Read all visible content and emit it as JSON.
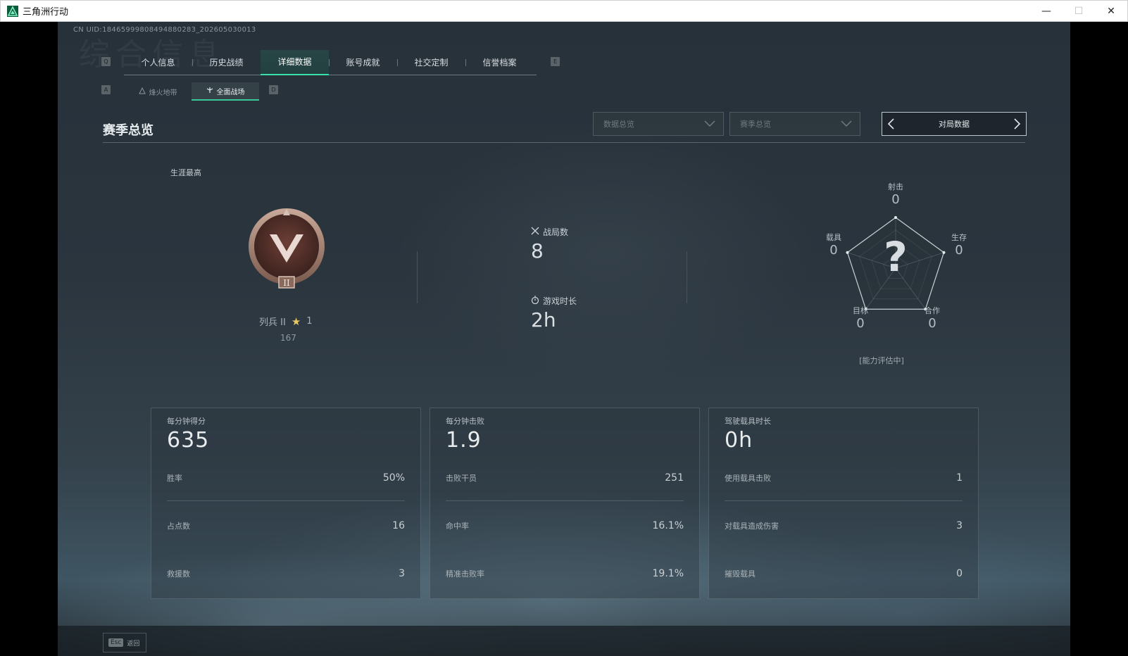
{
  "window": {
    "title": "三角洲行动",
    "minimize": "—",
    "maximize": "☐",
    "close": "✕"
  },
  "uid": "CN UID:18465999808494880283_202605030013",
  "background_text": "综合信息",
  "tabs": {
    "left_key": "Q",
    "right_key": "E",
    "items": [
      {
        "label": "个人信息",
        "active": false
      },
      {
        "label": "历史战绩",
        "active": false
      },
      {
        "label": "详细数据",
        "active": true
      },
      {
        "label": "账号成就",
        "active": false
      },
      {
        "label": "社交定制",
        "active": false
      },
      {
        "label": "信誉档案",
        "active": false
      }
    ]
  },
  "subtabs": {
    "left_key": "A",
    "right_key": "D",
    "items": [
      {
        "label": "烽火地带",
        "active": false
      },
      {
        "label": "全面战场",
        "active": true
      }
    ]
  },
  "section_title": "赛季总览",
  "filters": {
    "dropdown1": "数据总览",
    "dropdown2": "赛季总览",
    "pager": "对局数据"
  },
  "career": {
    "label": "生涯最高",
    "rank_name": "列兵 II",
    "stars": "1",
    "score": "167",
    "badge_numeral": "II"
  },
  "summary": {
    "matches_label": "战局数",
    "matches_value": "8",
    "playtime_label": "游戏时长",
    "playtime_value": "2h"
  },
  "radar": {
    "top": {
      "label": "射击",
      "value": "0"
    },
    "right": {
      "label": "生存",
      "value": "0"
    },
    "bottom_right": {
      "label": "合作",
      "value": "0"
    },
    "bottom_left": {
      "label": "目标",
      "value": "0"
    },
    "left": {
      "label": "载具",
      "value": "0"
    },
    "center_glyph": "?",
    "status": "[能力评估中]",
    "values": [
      0,
      0,
      0,
      0,
      0
    ]
  },
  "cards": [
    {
      "title": "每分钟得分",
      "big": "635",
      "rows": [
        {
          "label": "胜率",
          "value": "50%"
        },
        {
          "label": "占点数",
          "value": "16"
        },
        {
          "label": "救援数",
          "value": "3"
        }
      ]
    },
    {
      "title": "每分钟击败",
      "big": "1.9",
      "rows": [
        {
          "label": "击败干员",
          "value": "251"
        },
        {
          "label": "命中率",
          "value": "16.1%"
        },
        {
          "label": "精准击败率",
          "value": "19.1%"
        }
      ]
    },
    {
      "title": "驾驶载具时长",
      "big": "0h",
      "rows": [
        {
          "label": "使用载具击败",
          "value": "1"
        },
        {
          "label": "对载具造成伤害",
          "value": "3"
        },
        {
          "label": "摧毁载具",
          "value": "0"
        }
      ]
    }
  ],
  "footer": {
    "key": "Esc",
    "label": "返回"
  },
  "colors": {
    "accent": "#38e0a8",
    "panel": "#2b353e",
    "text": "#c9d1d6"
  }
}
